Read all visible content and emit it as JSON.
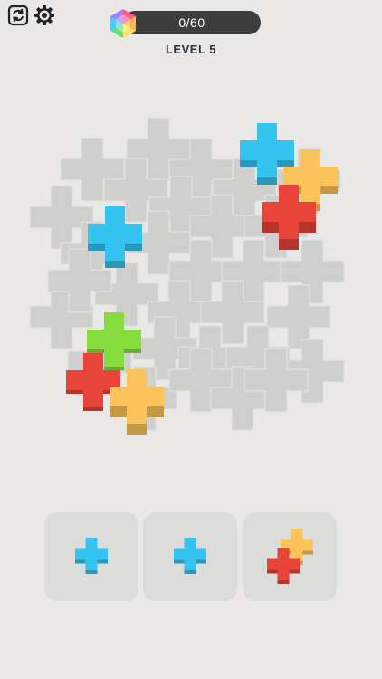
{
  "header": {
    "progress_text": "0/60",
    "progress_value": 0,
    "progress_max": 60,
    "level_text": "LEVEL 5"
  },
  "icons": {
    "restart": "restart-icon",
    "settings": "gear-icon",
    "gem": "rainbow-hexagon-gem-icon"
  },
  "colors": {
    "background": "#e9e8e6",
    "board_tile": "#cfcfcd",
    "tray": "#dcdcda",
    "cyan": "#35c4ef",
    "yellow": "#fbc45a",
    "red": "#e8443a",
    "green": "#86dc3e"
  },
  "board": {
    "placed_pieces": [
      {
        "color": "cyan",
        "stack": 2
      },
      {
        "color": "yellow",
        "stack": 2
      },
      {
        "color": "red",
        "stack": 3
      },
      {
        "color": "cyan",
        "stack": 2
      },
      {
        "color": "green",
        "stack": 1
      },
      {
        "color": "red",
        "stack": 1
      },
      {
        "color": "yellow",
        "stack": 3
      }
    ]
  },
  "trays": [
    {
      "pieces": [
        "cyan"
      ]
    },
    {
      "pieces": [
        "cyan"
      ]
    },
    {
      "pieces": [
        "yellow",
        "red"
      ]
    }
  ]
}
